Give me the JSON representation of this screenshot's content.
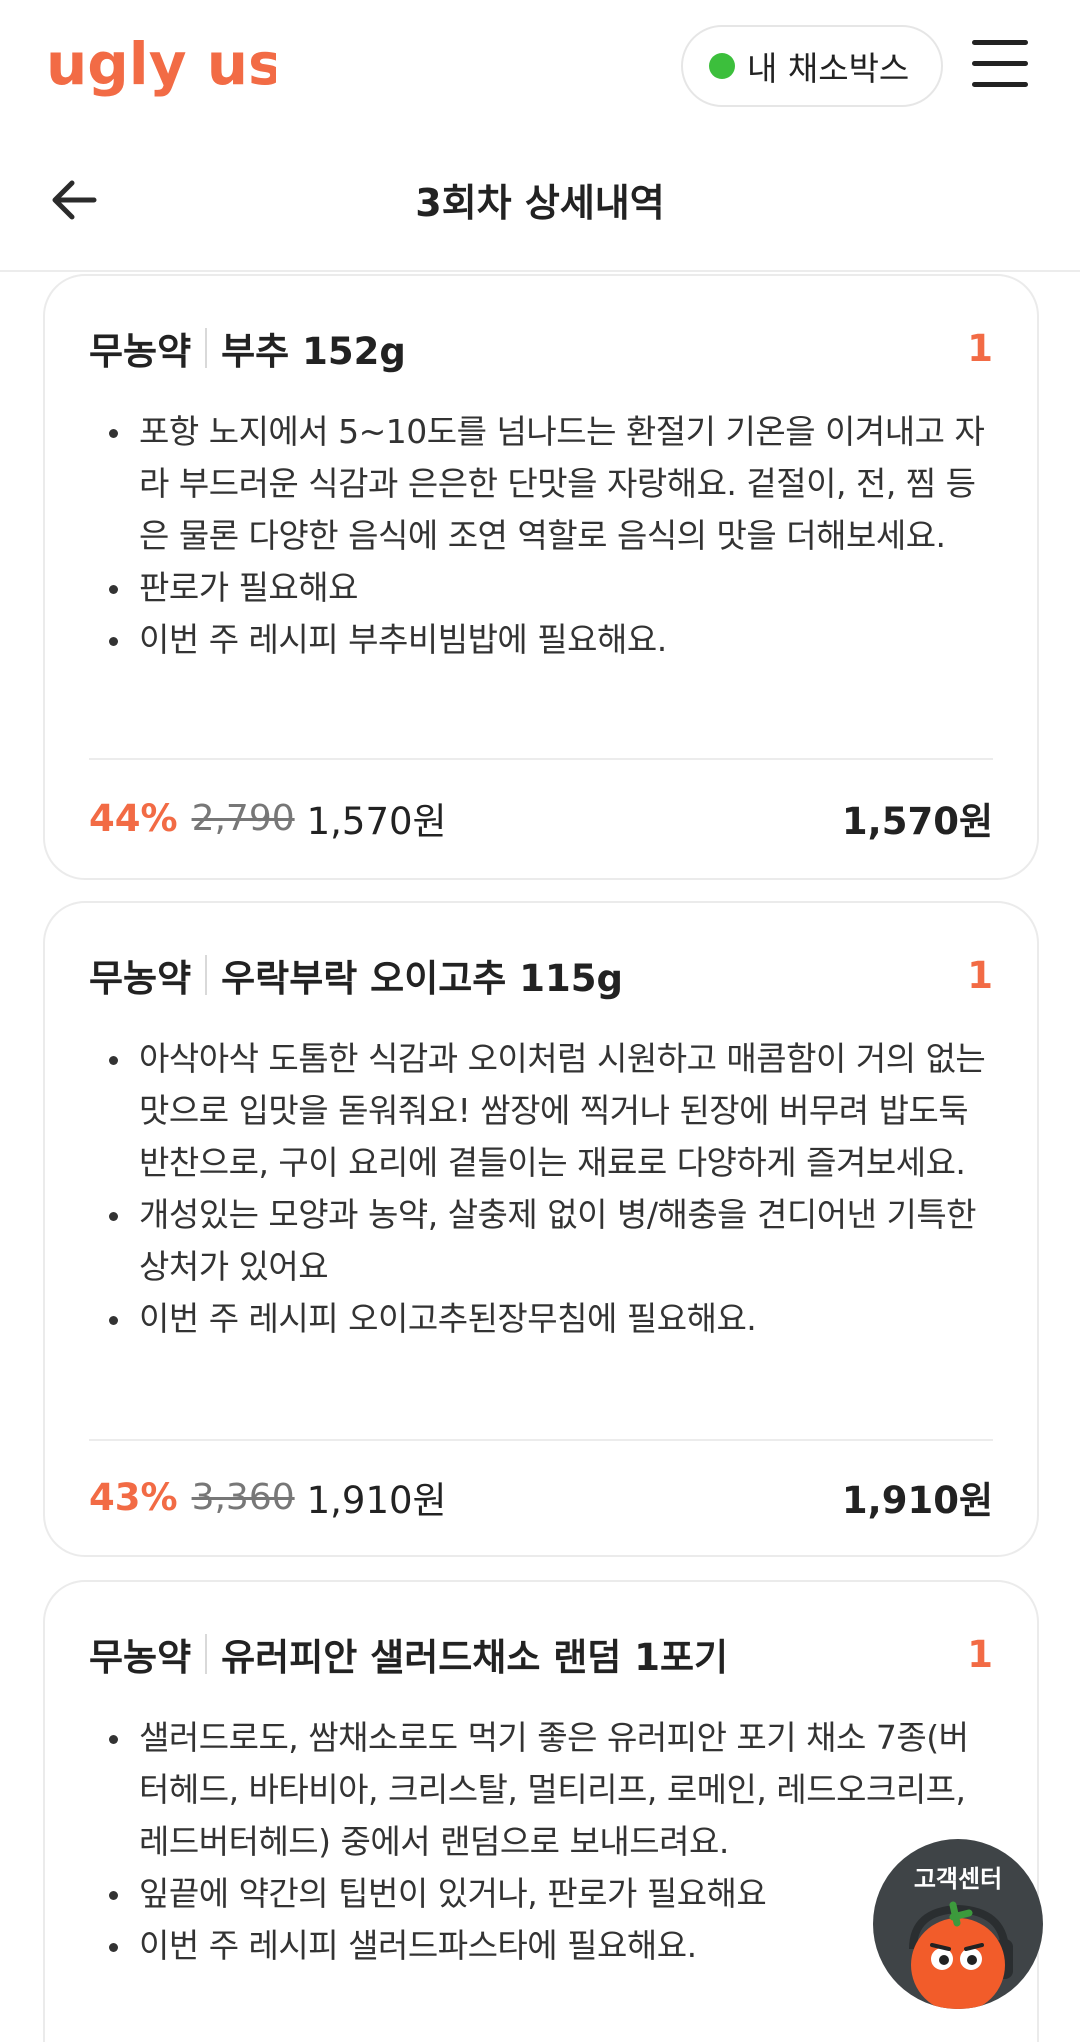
{
  "header": {
    "logo_text": "ugly us",
    "box_button_label": "내 채소박스",
    "box_status_color": "#3cbf3c",
    "menu_icon": "hamburger-menu-icon"
  },
  "subheader": {
    "back_icon": "arrow-left-icon",
    "title": "3회차 상세내역"
  },
  "items": [
    {
      "tag": "무농약",
      "name": "부추 152g",
      "quantity": "1",
      "bullets": [
        "포항 노지에서 5~10도를 넘나드는 환절기 기온을 이겨내고 자라 부드러운 식감과 은은한 단맛을 자랑해요. 겉절이, 전, 찜 등은 물론 다양한 음식에 조연 역할로 음식의 맛을 더해보세요.",
        "판로가 필요해요",
        "이번 주 레시피 부추비빔밥에 필요해요."
      ],
      "discount": "44%",
      "original_price": "2,790",
      "sale_price": "1,570원",
      "total": "1,570원"
    },
    {
      "tag": "무농약",
      "name": "우락부락 오이고추 115g",
      "quantity": "1",
      "bullets": [
        "아삭아삭 도톰한 식감과 오이처럼 시원하고 매콤함이 거의 없는 맛으로 입맛을 돋워줘요! 쌈장에 찍거나 된장에 버무려 밥도둑 반찬으로, 구이 요리에 곁들이는 재료로 다양하게 즐겨보세요.",
        "개성있는 모양과 농약, 살충제 없이 병/해충을 견디어낸 기특한 상처가 있어요",
        "이번 주 레시피 오이고추된장무침에 필요해요."
      ],
      "discount": "43%",
      "original_price": "3,360",
      "sale_price": "1,910원",
      "total": "1,910원"
    },
    {
      "tag": "무농약",
      "name": "유러피안 샐러드채소 랜덤 1포기",
      "quantity": "1",
      "bullets": [
        "샐러드로도, 쌈채소로도 먹기 좋은 유러피안 포기 채소 7종(버터헤드, 바타비아, 크리스탈, 멀티리프, 로메인, 레드오크리프, 레드버터헤드) 중에서 랜덤으로 보내드려요.",
        "잎끝에 약간의 팁번이 있거나, 판로가 필요해요",
        "이번 주 레시피 샐러드파스타에 필요해요."
      ]
    }
  ],
  "support": {
    "label": "고객센터",
    "icon": "tomato-headset-mascot-icon"
  },
  "colors": {
    "brand_orange": "#f26b45",
    "text_dark": "#222222",
    "fab_bg": "#3f4447"
  }
}
